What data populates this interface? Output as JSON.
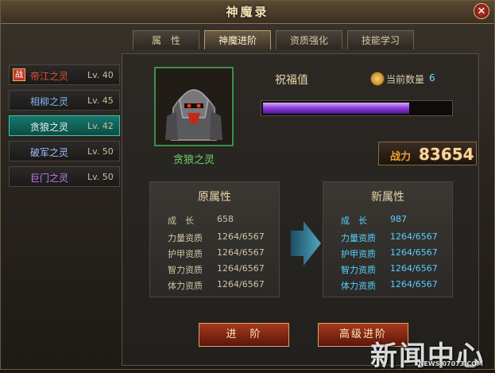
{
  "window": {
    "title": "神魔录",
    "close_glyph": "✕"
  },
  "tabs": [
    {
      "label": "属　性",
      "active": false
    },
    {
      "label": "神魔进阶",
      "active": true
    },
    {
      "label": "资质强化",
      "active": false
    },
    {
      "label": "技能学习",
      "active": false
    }
  ],
  "spirits": [
    {
      "name": "帝江之灵",
      "level": "Lv. 40",
      "color": "#e0503a",
      "badge": "战",
      "active": false
    },
    {
      "name": "相柳之灵",
      "level": "Lv. 45",
      "color": "#7fb6f0",
      "badge": "",
      "active": false
    },
    {
      "name": "贪狼之灵",
      "level": "Lv. 42",
      "color": "#e8f6f2",
      "badge": "",
      "active": true
    },
    {
      "name": "破军之灵",
      "level": "Lv. 50",
      "color": "#9bc0ff",
      "badge": "",
      "active": false
    },
    {
      "name": "巨门之灵",
      "level": "Lv. 50",
      "color": "#c27af2",
      "badge": "",
      "active": false
    }
  ],
  "selected": {
    "portrait_icon": "armored-warrior-portrait",
    "name": "贪狼之灵",
    "bless_label": "祝福值",
    "bless_progress": 0.78,
    "count_label": "当前数量",
    "count_value": "6",
    "power_label": "战力",
    "power_value": "83654"
  },
  "original_attrs": {
    "title": "原属性",
    "rows": [
      {
        "key": "成　长",
        "value": "658"
      },
      {
        "key": "力量资质",
        "value": "1264/6567"
      },
      {
        "key": "护甲资质",
        "value": "1264/6567"
      },
      {
        "key": "智力资质",
        "value": "1264/6567"
      },
      {
        "key": "体力资质",
        "value": "1264/6567"
      }
    ]
  },
  "new_attrs": {
    "title": "新属性",
    "rows": [
      {
        "key": "成　长",
        "value": "987"
      },
      {
        "key": "力量资质",
        "value": "1264/6567"
      },
      {
        "key": "护甲资质",
        "value": "1264/6567"
      },
      {
        "key": "智力资质",
        "value": "1264/6567"
      },
      {
        "key": "体力资质",
        "value": "1264/6567"
      }
    ]
  },
  "buttons": {
    "advance": "进　阶",
    "advanced_advance": "高级进阶"
  },
  "watermark": {
    "text": "新闻中心",
    "url": "NEWS.07073.COM"
  },
  "colors": {
    "accent_teal": "#17776c",
    "gold": "#f0a030",
    "progress_purple": "#8a3ad6",
    "green_name": "#6fd16c"
  }
}
